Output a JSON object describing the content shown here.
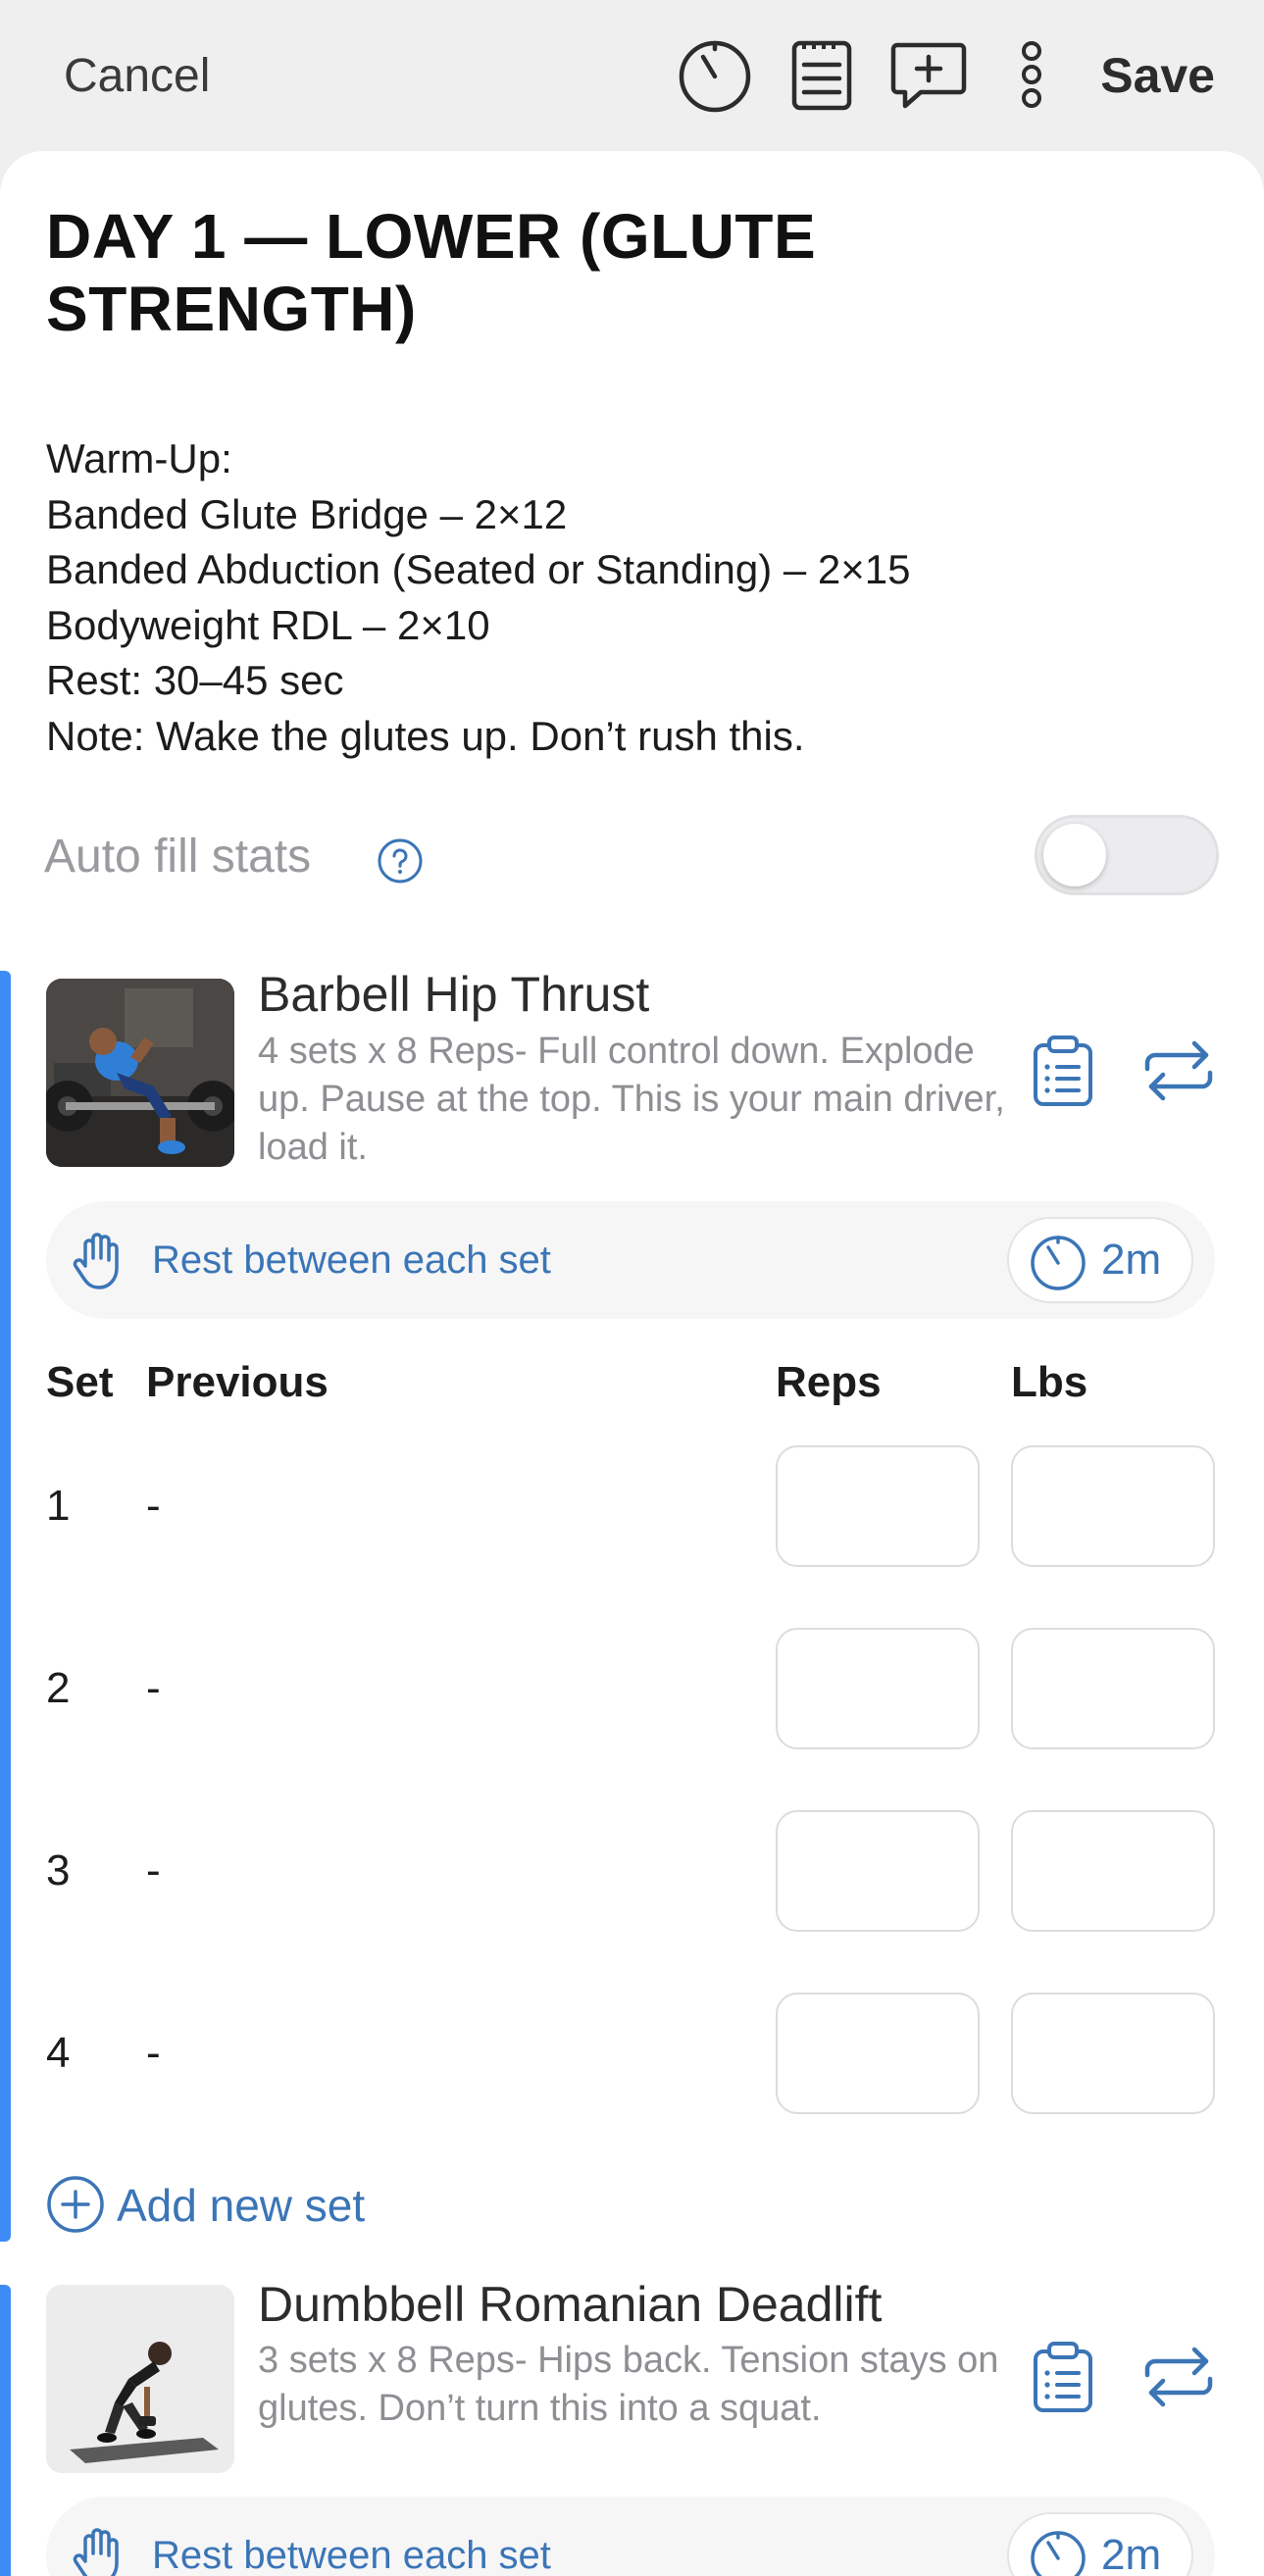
{
  "toolbar": {
    "cancel_label": "Cancel",
    "save_label": "Save",
    "icons": [
      "timer-icon",
      "notes-icon",
      "comment-add-icon",
      "more-vertical-icon"
    ]
  },
  "workout": {
    "title": "DAY 1 — LOWER (GLUTE STRENGTH)",
    "description_lines": [
      "Warm-Up:",
      "Banded Glute Bridge – 2×12",
      "Banded Abduction (Seated or Standing) – 2×15",
      "Bodyweight RDL – 2×10",
      "Rest: 30–45 sec",
      "Note: Wake the glutes up. Don’t rush this."
    ]
  },
  "auto_fill": {
    "label": "Auto fill stats",
    "enabled": false
  },
  "colors": {
    "accent": "#3e8bf5",
    "link": "#3b75b6",
    "muted_text": "#8e8e93"
  },
  "exercises": [
    {
      "name": "Barbell Hip Thrust",
      "note": "4 sets x 8 Reps- Full control down. Explode up. Pause at the top. This is your main driver, load it.",
      "rest_label": "Rest between each set",
      "rest_time": "2m"
    },
    {
      "name": "Dumbbell Romanian Deadlift",
      "note": "3 sets x 8 Reps- Hips back. Tension stays on glutes. Don’t turn this into a squat.",
      "rest_label": "Rest between each set",
      "rest_time": "2m"
    }
  ],
  "set_table": {
    "headers": {
      "set": "Set",
      "previous": "Previous",
      "reps": "Reps",
      "lbs": "Lbs"
    },
    "rows": [
      {
        "set": "1",
        "previous": "-",
        "reps": "",
        "lbs": ""
      },
      {
        "set": "2",
        "previous": "-",
        "reps": "",
        "lbs": ""
      },
      {
        "set": "3",
        "previous": "-",
        "reps": "",
        "lbs": ""
      },
      {
        "set": "4",
        "previous": "-",
        "reps": "",
        "lbs": ""
      }
    ],
    "add_set_label": "Add new set"
  }
}
